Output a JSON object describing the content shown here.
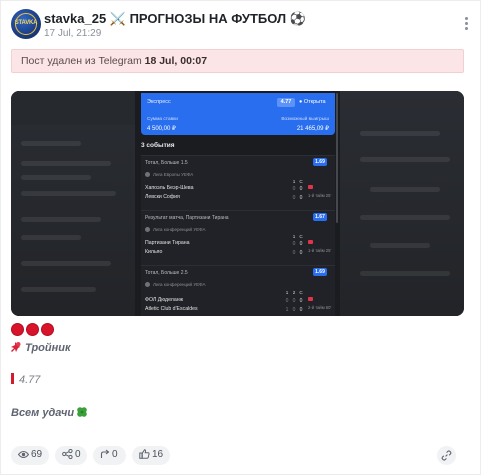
{
  "channel": {
    "title": "stavka_25 ⚔️ ПРОГНОЗЫ НА ФУТБОЛ ⚽",
    "date": "17 Jul, 21:29",
    "avatar_text": "STAVKA"
  },
  "banner": {
    "text": "Пост удален из Telegram ",
    "datetime": "18 Jul, 00:07"
  },
  "screenshot": {
    "ticket_type": "Экспресс",
    "total_odds": "4.77",
    "status": "Открыта",
    "stake_label": "Сумма ставки",
    "stake_value": "4 500,00 ₽",
    "win_label": "Возможный выигрыш",
    "win_value": "21 465,09 ₽",
    "events_count": "3 события",
    "events": [
      {
        "market": "Тотал, Больше 1.5",
        "odds": "1.69",
        "league": "Лига Европы УЕФА",
        "team1": "Хапоэль Беэр-Шева",
        "team2": "Левски София",
        "score_head": [
          "1",
          "С"
        ],
        "score1": [
          "0",
          "0"
        ],
        "score2": [
          "0",
          "0"
        ],
        "period": "1-й тайм 25'"
      },
      {
        "market": "Результат матча, Партизани Тирана",
        "odds": "1.67",
        "league": "Лига конференций УЕФА",
        "team1": "Партизани Тирана",
        "team2": "Кильяо",
        "score_head": [
          "1",
          "С"
        ],
        "score1": [
          "0",
          "0"
        ],
        "score2": [
          "0",
          "0"
        ],
        "period": "1-й тайм 25'"
      },
      {
        "market": "Тотал, Больше 2.5",
        "odds": "1.69",
        "league": "Лига конференций УЕФА",
        "team1": "ФОЛ Дюделанж",
        "team2": "Atletic Club d'Escaldes",
        "score_head": [
          "1",
          "2",
          "С"
        ],
        "score1": [
          "0",
          "0",
          "0"
        ],
        "score2": [
          "1",
          "0",
          "0"
        ],
        "period": "2-й тайм 60'"
      }
    ]
  },
  "content": {
    "line_triple": "Тройник",
    "line_odds": "4.77",
    "line_luck": "Всем удачи"
  },
  "footer": {
    "views": "69",
    "shares": "0",
    "forwards": "0",
    "likes": "16"
  },
  "colors": {
    "accent_blue": "#2a6ef0",
    "banner_pink": "#fbe5e6",
    "red_dot": "#d9132a"
  },
  "icons": [
    "menu-dots-icon",
    "pin-icon",
    "red-bar-icon",
    "clover-icon",
    "eye-icon",
    "share-icon",
    "forward-icon",
    "thumbs-up-icon",
    "link-icon"
  ]
}
